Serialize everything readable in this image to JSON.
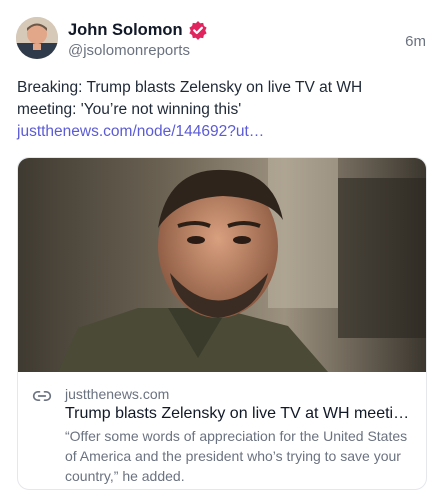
{
  "author": {
    "name": "John Solomon",
    "handle": "@jsolomonreports",
    "avatar_icon": "avatar-photo",
    "verified_icon": "verified-badge-icon",
    "verified_color": "#e0245e"
  },
  "timestamp": "6m",
  "post": {
    "text": "Breaking: Trump blasts Zelensky on live TV at WH meeting: 'You’re not winning this' ",
    "link_text": "justthenews.com/node/144692?ut…",
    "link_color": "#5b5bd6"
  },
  "link_card": {
    "icon": "link-icon",
    "domain": "justthenews.com",
    "title": "Trump blasts Zelensky on live TV at WH meetin…",
    "description": "“Offer some words of appreciation for the United States of America and the president who’s trying to save your country,” he added."
  }
}
